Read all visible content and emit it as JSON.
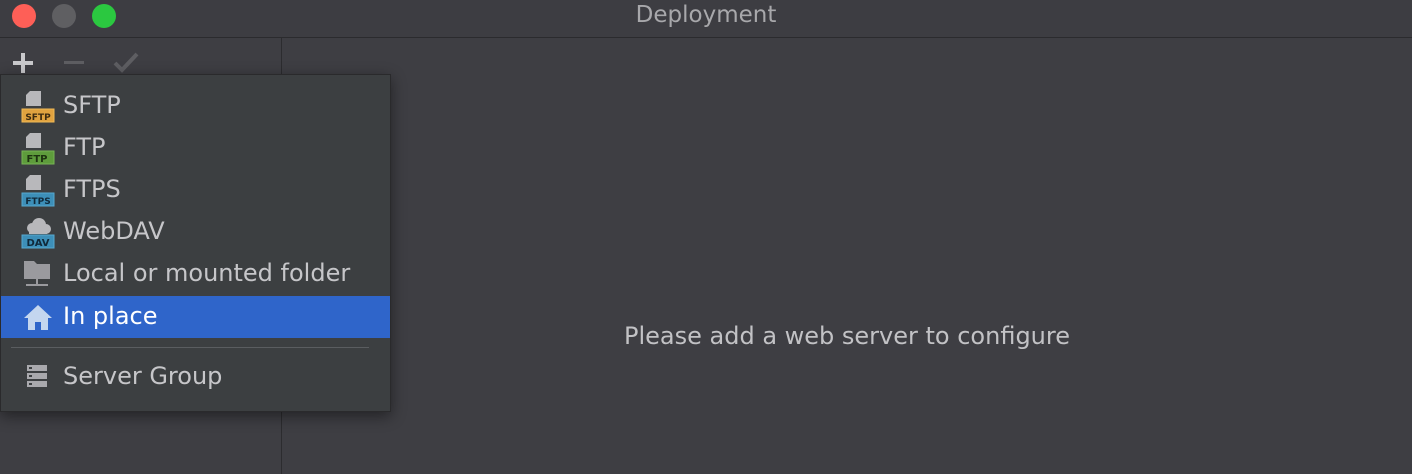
{
  "window": {
    "title": "Deployment"
  },
  "toolbar": {
    "add_icon": "plus-icon",
    "remove_icon": "minus-icon",
    "apply_icon": "check-icon"
  },
  "popup": {
    "items": [
      {
        "label": "SFTP",
        "icon": "sftp-icon",
        "icon_text": "SFTP",
        "color": "#e0a23f"
      },
      {
        "label": "FTP",
        "icon": "ftp-icon",
        "icon_text": "FTP",
        "color": "#5e9c3c"
      },
      {
        "label": "FTPS",
        "icon": "ftps-icon",
        "icon_text": "FTPS",
        "color": "#3d8fb8"
      },
      {
        "label": "WebDAV",
        "icon": "webdav-icon",
        "icon_text": "DAV",
        "color": "#3d8fb8"
      },
      {
        "label": "Local or mounted folder",
        "icon": "folder-icon"
      },
      {
        "label": "In place",
        "icon": "home-icon",
        "selected": true
      },
      {
        "label": "Server Group",
        "icon": "server-group-icon"
      }
    ]
  },
  "main": {
    "empty_message": "Please add a web server to configure"
  },
  "colors": {
    "selection": "#2f65ca",
    "background": "#3e3e43"
  }
}
